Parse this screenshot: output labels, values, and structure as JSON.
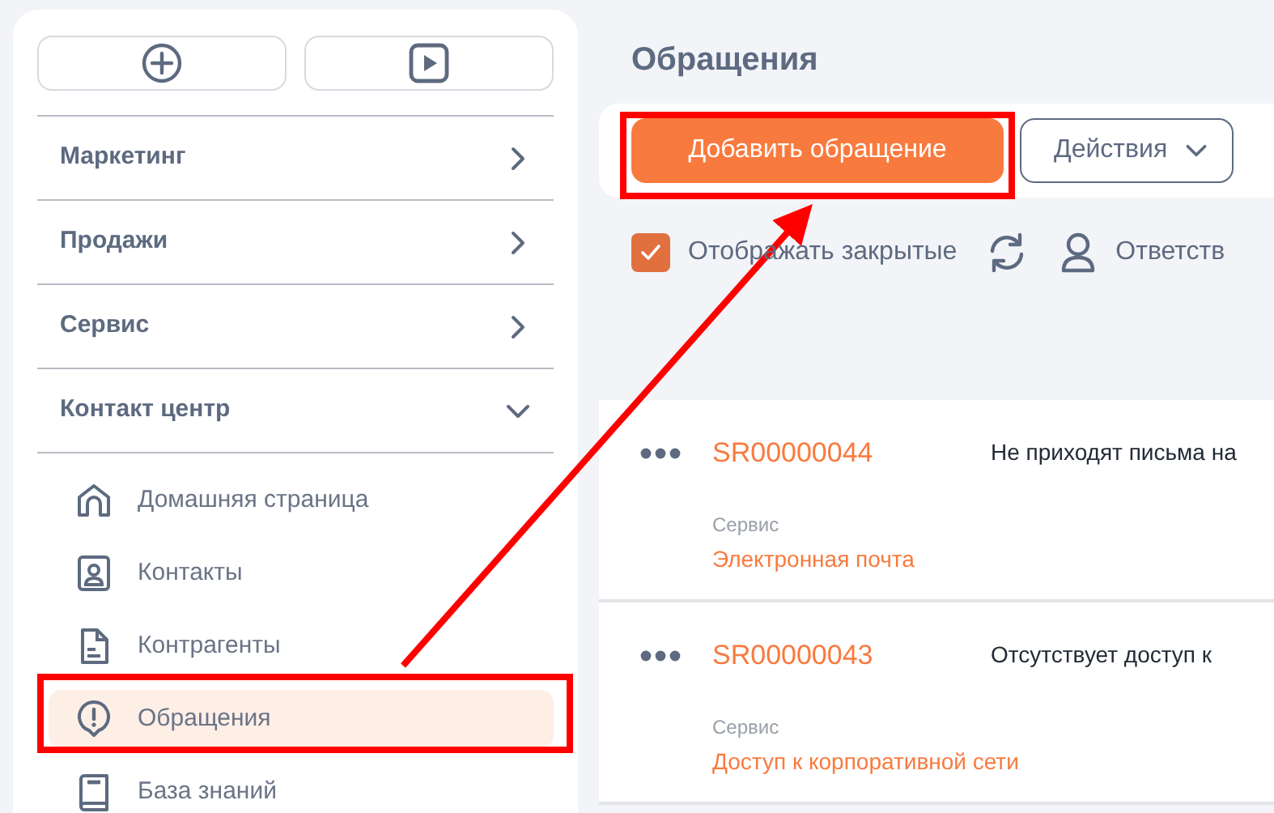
{
  "sidebar": {
    "groups": [
      {
        "label": "Маркетинг",
        "expanded": false
      },
      {
        "label": "Продажи",
        "expanded": false
      },
      {
        "label": "Сервис",
        "expanded": false
      },
      {
        "label": "Контакт центр",
        "expanded": true
      }
    ],
    "items": [
      {
        "label": "Домашняя страница",
        "kind": "home",
        "selected": false
      },
      {
        "label": "Контакты",
        "kind": "contact",
        "selected": false
      },
      {
        "label": "Контрагенты",
        "kind": "document",
        "selected": false
      },
      {
        "label": "Обращения",
        "kind": "alert",
        "selected": true
      },
      {
        "label": "База знаний",
        "kind": "book",
        "selected": false
      }
    ]
  },
  "page": {
    "title": "Обращения"
  },
  "toolbar": {
    "primary_button": "Добавить обращение",
    "actions_button": "Действия"
  },
  "filters": {
    "show_closed": {
      "label": "Отображать закрытые",
      "checked": true
    },
    "responsible": "Ответств"
  },
  "cases": [
    {
      "number": "SR00000044",
      "subject": "Не приходят письма на",
      "category_label": "Сервис",
      "category": "Электронная почта"
    },
    {
      "number": "SR00000043",
      "subject": "Отсутствует доступ к",
      "category_label": "Сервис",
      "category": "Доступ к корпоративной сети"
    }
  ]
}
